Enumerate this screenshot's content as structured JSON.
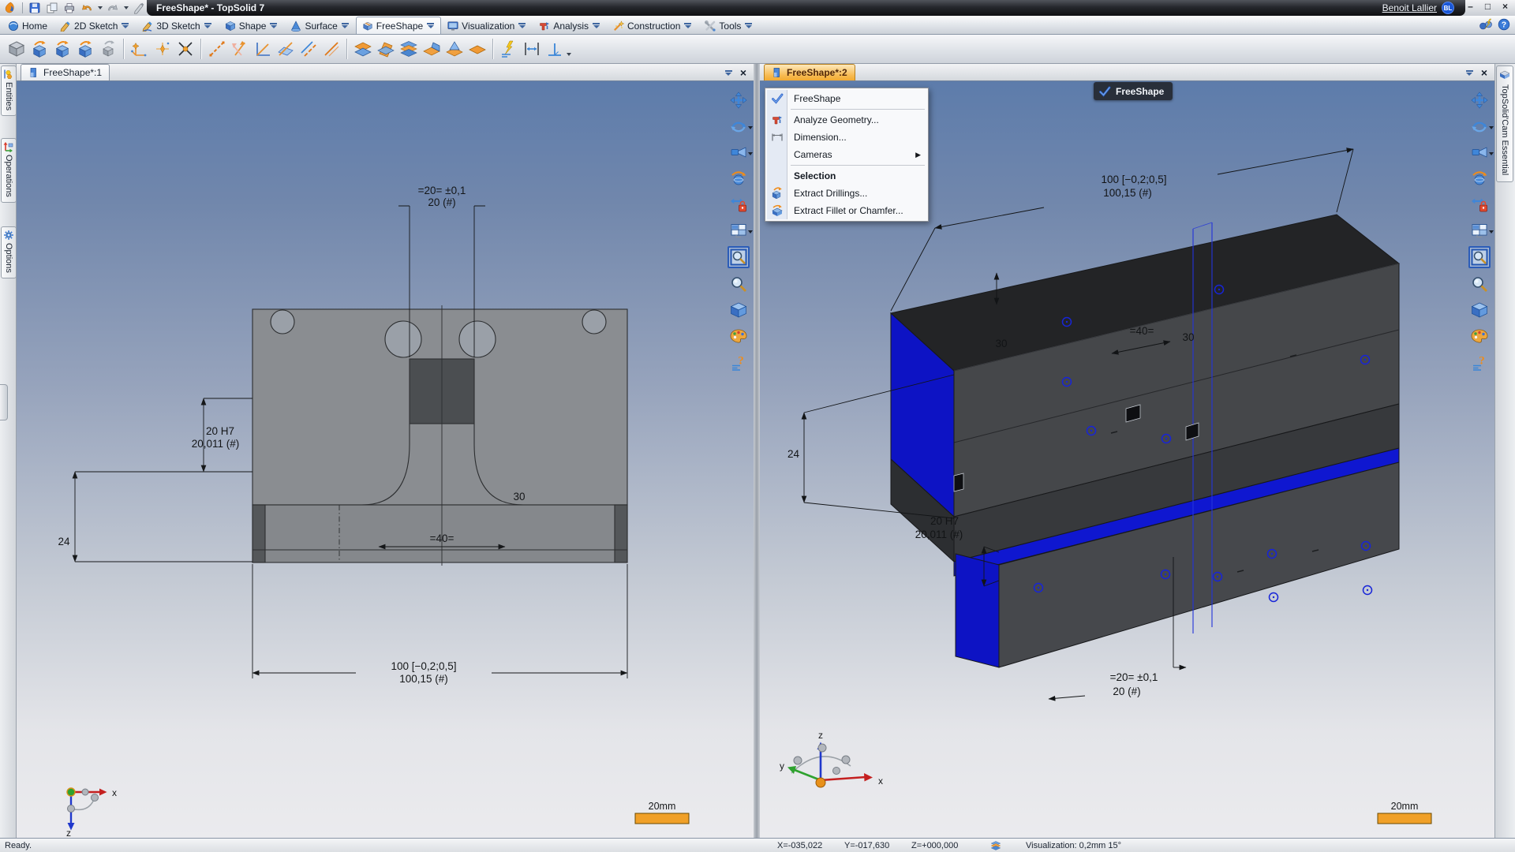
{
  "window": {
    "title": "FreeShape* - TopSolid 7",
    "user_name": "Benoit Lallier",
    "user_initials": "BL"
  },
  "glyphs": {
    "close": "×",
    "minimize": "–",
    "maximize": "□",
    "submenu": "▶"
  },
  "quick_access": {
    "icons": [
      "topsolid-logo",
      "save",
      "copy",
      "print",
      "undo",
      "redo",
      "pen-measure",
      "refresh"
    ]
  },
  "ribbon": {
    "tabs": [
      {
        "label": "Home"
      },
      {
        "label": "2D Sketch"
      },
      {
        "label": "3D Sketch"
      },
      {
        "label": "Shape"
      },
      {
        "label": "Surface"
      },
      {
        "label": "FreeShape",
        "active": true
      },
      {
        "label": "Visualization"
      },
      {
        "label": "Analysis"
      },
      {
        "label": "Construction"
      },
      {
        "label": "Tools"
      }
    ]
  },
  "toolbar": {
    "icons": [
      "shape-gray",
      "extrude-shape",
      "revolve-shape",
      "loft-shape",
      "shape-arrow",
      "axis-frame",
      "point",
      "intersection-point",
      "dashed-line",
      "axis-lines",
      "angle-lines",
      "plane-line",
      "parallel-line",
      "segment-line",
      "plane-pair",
      "plane-tilted",
      "plane-stack",
      "plane-fold",
      "plane-corner",
      "plane-flat",
      "ground-lightning-measure",
      "distance-measure",
      "perpendicular-measure"
    ]
  },
  "left_panel": {
    "tabs": [
      {
        "label": "Entities"
      },
      {
        "label": "Operations"
      },
      {
        "label": "Options"
      }
    ]
  },
  "right_panel": {
    "label": "TopSolid'Cam Essential"
  },
  "documents": [
    {
      "label": "FreeShape*:1"
    },
    {
      "label": "FreeShape*:2",
      "active": true
    }
  ],
  "context_menu": {
    "items": [
      {
        "label": "FreeShape",
        "icon": "check"
      },
      {
        "label": "Analyze Geometry...",
        "icon": "analyze"
      },
      {
        "label": "Dimension...",
        "icon": "dimension"
      },
      {
        "label": "Cameras",
        "submenu": true
      },
      {
        "label": "Selection",
        "header": true
      },
      {
        "label": "Extract Drillings...",
        "icon": "extract-drillings"
      },
      {
        "label": "Extract Fillet or Chamfer...",
        "icon": "extract-fillet"
      }
    ]
  },
  "overlay_badge": {
    "label": "FreeShape"
  },
  "viewport_tools": {
    "icons": [
      "pan",
      "orbit",
      "camera-view",
      "rotate-view",
      "translate-lock",
      "viewport-layout",
      "zoom-window",
      "zoom",
      "render-style",
      "palette",
      "help-lines"
    ]
  },
  "dims": {
    "d20_l1": "=20= ±0,1",
    "d20_l2": "20 (#)",
    "d20h7_l1": "20 H7",
    "d20h7_l2": "20,011 (#)",
    "d24": "24",
    "d30": "30",
    "d40": "=40=",
    "d100_l1": "100 [−0,2;0,5]",
    "d100_l2": "100,15 (#)"
  },
  "axis": {
    "x": "x",
    "y": "y",
    "z": "z"
  },
  "scale_label": "20mm",
  "status": {
    "message": "Ready.",
    "coord_x": "X=-035,022",
    "coord_y": "Y=-017,630",
    "coord_z": "Z=+000,000",
    "visualization": "Visualization: 0,2mm 15°"
  },
  "colors": {
    "accent_orange": "#f3ab33",
    "selection_blue": "#0f16c9",
    "viewport_top": "#5d7cab",
    "titlebar_dark": "#17181c"
  }
}
